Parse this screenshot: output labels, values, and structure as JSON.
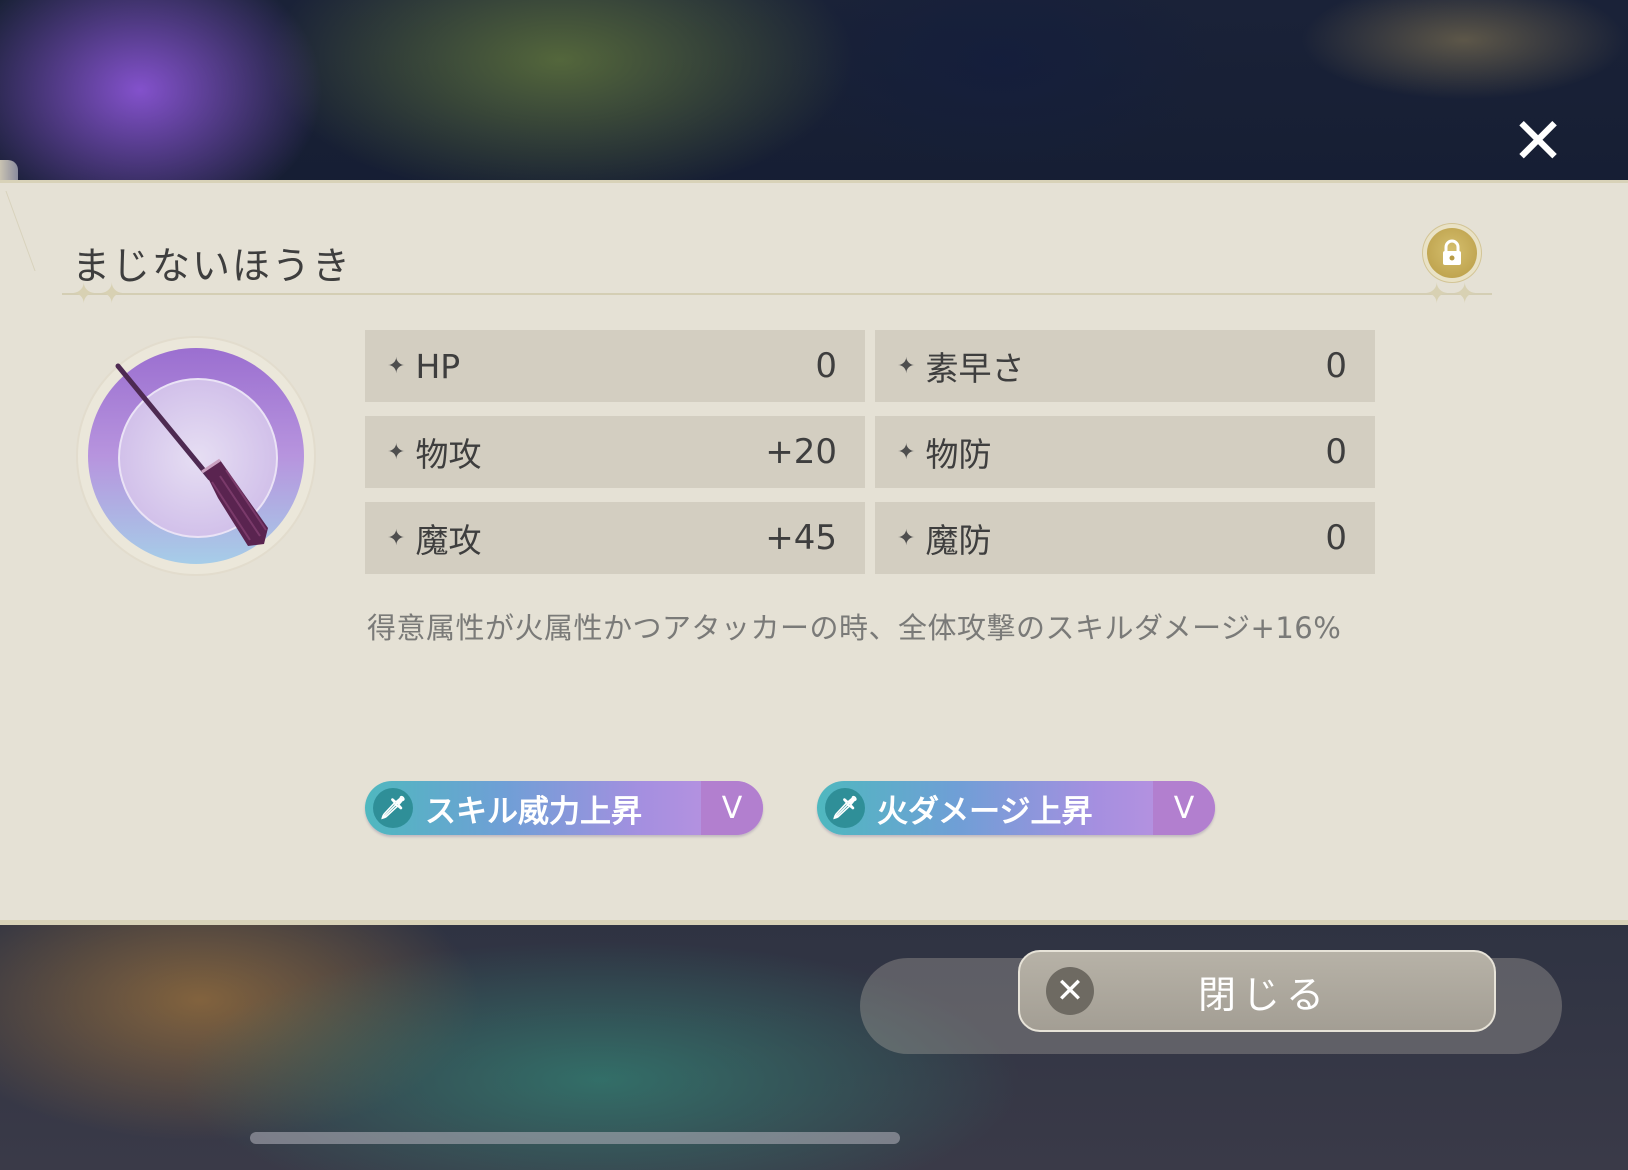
{
  "item": {
    "name": "まじないほうき",
    "locked": true
  },
  "stats": [
    {
      "label": "HP",
      "value": "0"
    },
    {
      "label": "素早さ",
      "value": "0"
    },
    {
      "label": "物攻",
      "value": "+20"
    },
    {
      "label": "物防",
      "value": "0"
    },
    {
      "label": "魔攻",
      "value": "+45"
    },
    {
      "label": "魔防",
      "value": "0"
    }
  ],
  "description": "得意属性が火属性かつアタッカーの時、全体攻撃のスキルダメージ+16%",
  "skills": [
    {
      "label": "スキル威力上昇",
      "level": "V"
    },
    {
      "label": "火ダメージ上昇",
      "level": "V"
    }
  ],
  "buttons": {
    "close_label": "閉じる"
  },
  "colors": {
    "panel_bg": "#e5e1d5",
    "stat_bg": "#d3cec1",
    "lock_gold": "#c8ad58",
    "badge_teal": "#4fb8bf",
    "badge_purple": "#c294e0"
  },
  "icons": {
    "item": "broom-icon",
    "lock": "lock-icon",
    "skill": "sword-icon",
    "close": "close-icon"
  }
}
